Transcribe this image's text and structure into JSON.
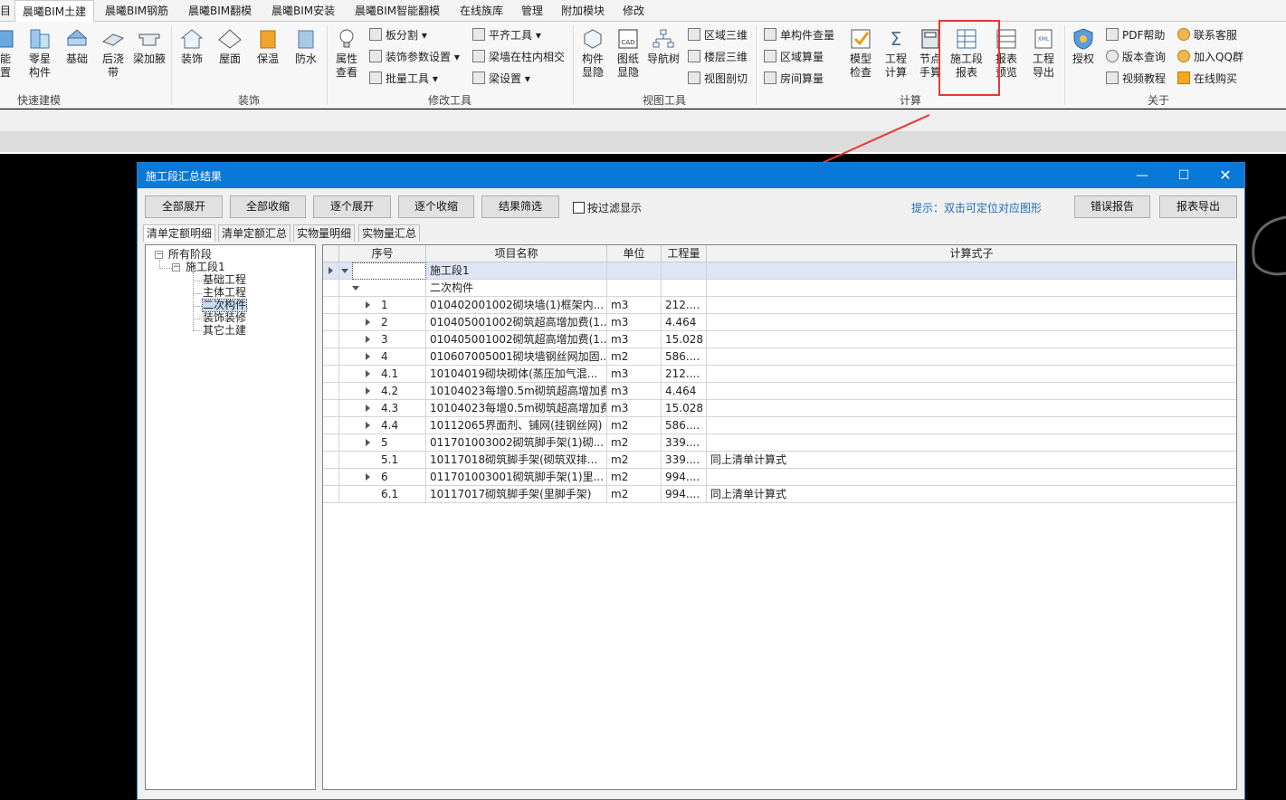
{
  "ribbon_tabs": [
    "目",
    "晨曦BIM土建",
    "晨曦BIM钢筋",
    "晨曦BIM翻模",
    "晨曦BIM安装",
    "晨曦BIM智能翻模",
    "在线族库",
    "管理",
    "附加模块",
    "修改"
  ],
  "ribbon_active_tab": "晨曦BIM土建",
  "ribbon": {
    "quick": {
      "label": "快速建模",
      "buttons": [
        "能\n置",
        "零星\n构件",
        "基础",
        "后浇\n带",
        "梁加腋"
      ]
    },
    "decor": {
      "label": "装饰",
      "buttons": [
        "装饰",
        "屋面",
        "保温",
        "防水"
      ]
    },
    "modify": {
      "label": "修改工具",
      "big": "属性\n查看",
      "small": [
        "板分割",
        "装饰参数设置",
        "批量工具",
        "平齐工具",
        "梁墙在柱内相交",
        "梁设置"
      ]
    },
    "view": {
      "label": "视图工具",
      "big": [
        "构件\n显隐",
        "图纸\n显隐",
        "导航树"
      ],
      "small": [
        "区域三维",
        "楼层三维",
        "视图剖切"
      ]
    },
    "calc": {
      "label": "计算",
      "small": [
        "单构件查量",
        "区域算量",
        "房间算量"
      ],
      "big": [
        "模型\n检查",
        "工程\n计算",
        "节点\n手算",
        "施工段\n报表",
        "报表\n预览",
        "工程\n导出"
      ]
    },
    "about": {
      "label": "关于",
      "big": "授权",
      "small": [
        "PDF帮助",
        "版本查询",
        "视频教程",
        "联系客服",
        "加入QQ群",
        "在线购买"
      ]
    }
  },
  "dialog": {
    "title": "施工段汇总结果",
    "buttons": [
      "全部展开",
      "全部收缩",
      "逐个展开",
      "逐个收缩",
      "结果筛选"
    ],
    "filter_label": "按过滤显示",
    "hint": "提示：双击可定位对应图形",
    "right_buttons": [
      "错误报告",
      "报表导出"
    ],
    "tabs": [
      "清单定额明细",
      "清单定额汇总",
      "实物量明细",
      "实物量汇总"
    ],
    "active_tab": "清单定额明细",
    "tree": {
      "root": "所有阶段",
      "stage": "施工段1",
      "children": [
        "基础工程",
        "主体工程",
        "二次构件",
        "装饰装修",
        "其它土建"
      ],
      "selected": "二次构件"
    },
    "grid": {
      "columns": [
        "序号",
        "项目名称",
        "单位",
        "工程量",
        "计算式子"
      ],
      "group": "施工段1",
      "subgroup": "二次构件",
      "rows": [
        {
          "no": "1",
          "name": "010402001002砌块墙(1)框架内...",
          "unit": "m3",
          "qty": "212....",
          "formula": "",
          "expandable": true
        },
        {
          "no": "2",
          "name": "010405001002砌筑超高增加费(1...",
          "unit": "m3",
          "qty": "4.464",
          "formula": "",
          "expandable": true
        },
        {
          "no": "3",
          "name": "010405001002砌筑超高增加费(1...",
          "unit": "m3",
          "qty": "15.028",
          "formula": "",
          "expandable": true
        },
        {
          "no": "4",
          "name": "010607005001砌块墙钢丝网加固...",
          "unit": "m2",
          "qty": "586....",
          "formula": "",
          "expandable": true
        },
        {
          "no": "4.1",
          "name": "10104019砌块砌体(蒸压加气混...",
          "unit": "m3",
          "qty": "212....",
          "formula": "",
          "expandable": true
        },
        {
          "no": "4.2",
          "name": "10104023每增0.5m砌筑超高增加费",
          "unit": "m3",
          "qty": "4.464",
          "formula": "",
          "expandable": true
        },
        {
          "no": "4.3",
          "name": "10104023每增0.5m砌筑超高增加费",
          "unit": "m3",
          "qty": "15.028",
          "formula": "",
          "expandable": true
        },
        {
          "no": "4.4",
          "name": "10112065界面剂、铺网(挂钢丝网)",
          "unit": "m2",
          "qty": "586....",
          "formula": "",
          "expandable": true
        },
        {
          "no": "5",
          "name": "011701003002砌筑脚手架(1)砌...",
          "unit": "m2",
          "qty": "339....",
          "formula": "",
          "expandable": true
        },
        {
          "no": "5.1",
          "name": "10117018砌筑脚手架(砌筑双排...",
          "unit": "m2",
          "qty": "339....",
          "formula": "同上清单计算式",
          "expandable": false
        },
        {
          "no": "6",
          "name": "011701003001砌筑脚手架(1)里...",
          "unit": "m2",
          "qty": "994....",
          "formula": "",
          "expandable": true
        },
        {
          "no": "6.1",
          "name": "10117017砌筑脚手架(里脚手架)",
          "unit": "m2",
          "qty": "994....",
          "formula": "同上清单计算式",
          "expandable": false
        }
      ]
    }
  },
  "colors": {
    "title_bar": "#0a78d7",
    "highlight": "#e53935",
    "hint": "#1a6bb8"
  }
}
